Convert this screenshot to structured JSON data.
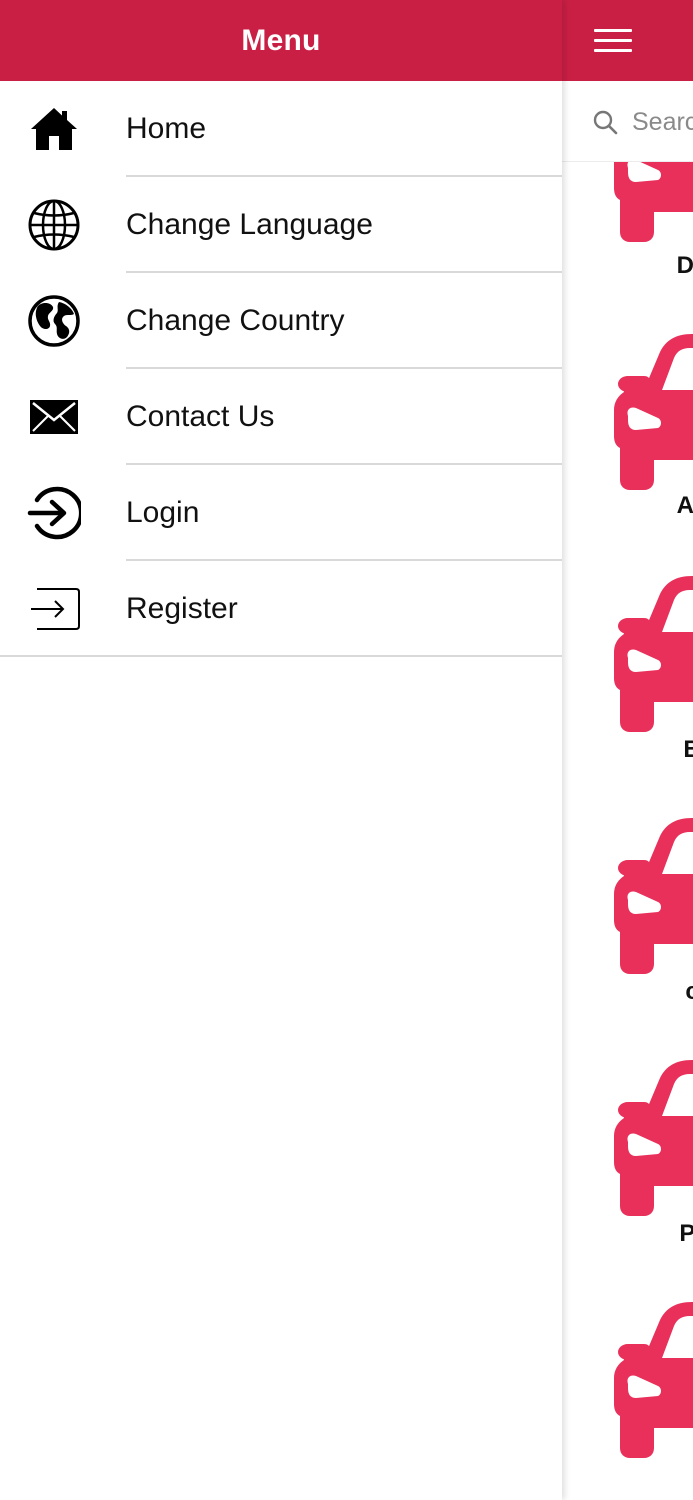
{
  "drawer": {
    "title": "Menu",
    "items": [
      {
        "label": "Home",
        "icon": "home-icon"
      },
      {
        "label": "Change Language",
        "icon": "globe-grid-icon"
      },
      {
        "label": "Change Country",
        "icon": "earth-icon"
      },
      {
        "label": "Contact Us",
        "icon": "envelope-icon"
      },
      {
        "label": "Login",
        "icon": "login-icon"
      },
      {
        "label": "Register",
        "icon": "register-icon"
      }
    ]
  },
  "main": {
    "search": {
      "placeholder": "Search"
    },
    "car_items": [
      {
        "label": "Da"
      },
      {
        "label": "Ac"
      },
      {
        "label": "B"
      },
      {
        "label": "c"
      },
      {
        "label": "Pr"
      },
      {
        "label": ""
      }
    ]
  },
  "colors": {
    "header": "#c91f45",
    "car_icon": "#e8305a",
    "divider": "#d9d9d9"
  }
}
